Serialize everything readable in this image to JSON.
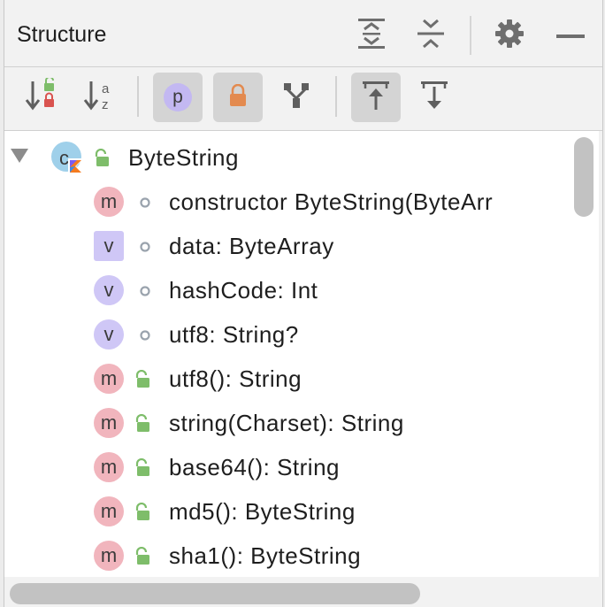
{
  "panel": {
    "title": "Structure",
    "header_buttons": [
      {
        "name": "expand-all-icon"
      },
      {
        "name": "collapse-all-icon"
      },
      {
        "name": "settings-gear-icon"
      },
      {
        "name": "hide-panel-icon"
      }
    ]
  },
  "toolbar": {
    "sort_by_visibility": {
      "icon": "sort-visibility-icon",
      "selected": false
    },
    "sort_alphabetically": {
      "icon": "sort-alpha-icon",
      "selected": false
    },
    "show_properties": {
      "label": "p",
      "selected": true
    },
    "show_non_public": {
      "icon": "lock-icon",
      "selected": true
    },
    "show_inherited": {
      "icon": "inherited-icon",
      "selected": false
    },
    "autoscroll_to_source": {
      "icon": "autoscroll-to-source-icon",
      "selected": true
    },
    "autoscroll_from_source": {
      "icon": "autoscroll-from-source-icon",
      "selected": false
    }
  },
  "tree": {
    "root": {
      "label": "ByteString",
      "kind": "c",
      "kind_icon": "kotlin-class-icon",
      "visibility_icon": "public-lock-icon",
      "expanded": true
    },
    "items": [
      {
        "kind": "m",
        "label": "constructor ByteString(ByteArr",
        "visibility": "package-dot"
      },
      {
        "kind": "v",
        "label": "data: ByteArray",
        "visibility": "package-dot",
        "square": true
      },
      {
        "kind": "v",
        "label": "hashCode: Int",
        "visibility": "package-dot"
      },
      {
        "kind": "v",
        "label": "utf8: String?",
        "visibility": "package-dot"
      },
      {
        "kind": "m",
        "label": "utf8(): String",
        "visibility": "public-lock"
      },
      {
        "kind": "m",
        "label": "string(Charset): String",
        "visibility": "public-lock"
      },
      {
        "kind": "m",
        "label": "base64(): String",
        "visibility": "public-lock"
      },
      {
        "kind": "m",
        "label": "md5(): ByteString",
        "visibility": "public-lock"
      },
      {
        "kind": "m",
        "label": "sha1(): ByteString",
        "visibility": "public-lock"
      }
    ]
  },
  "colors": {
    "method_badge": "#f1b5bd",
    "variable_badge": "#cfc7f6",
    "unlocked_green": "#7ebd6a",
    "private_lock_orange": "#e38a4f"
  }
}
